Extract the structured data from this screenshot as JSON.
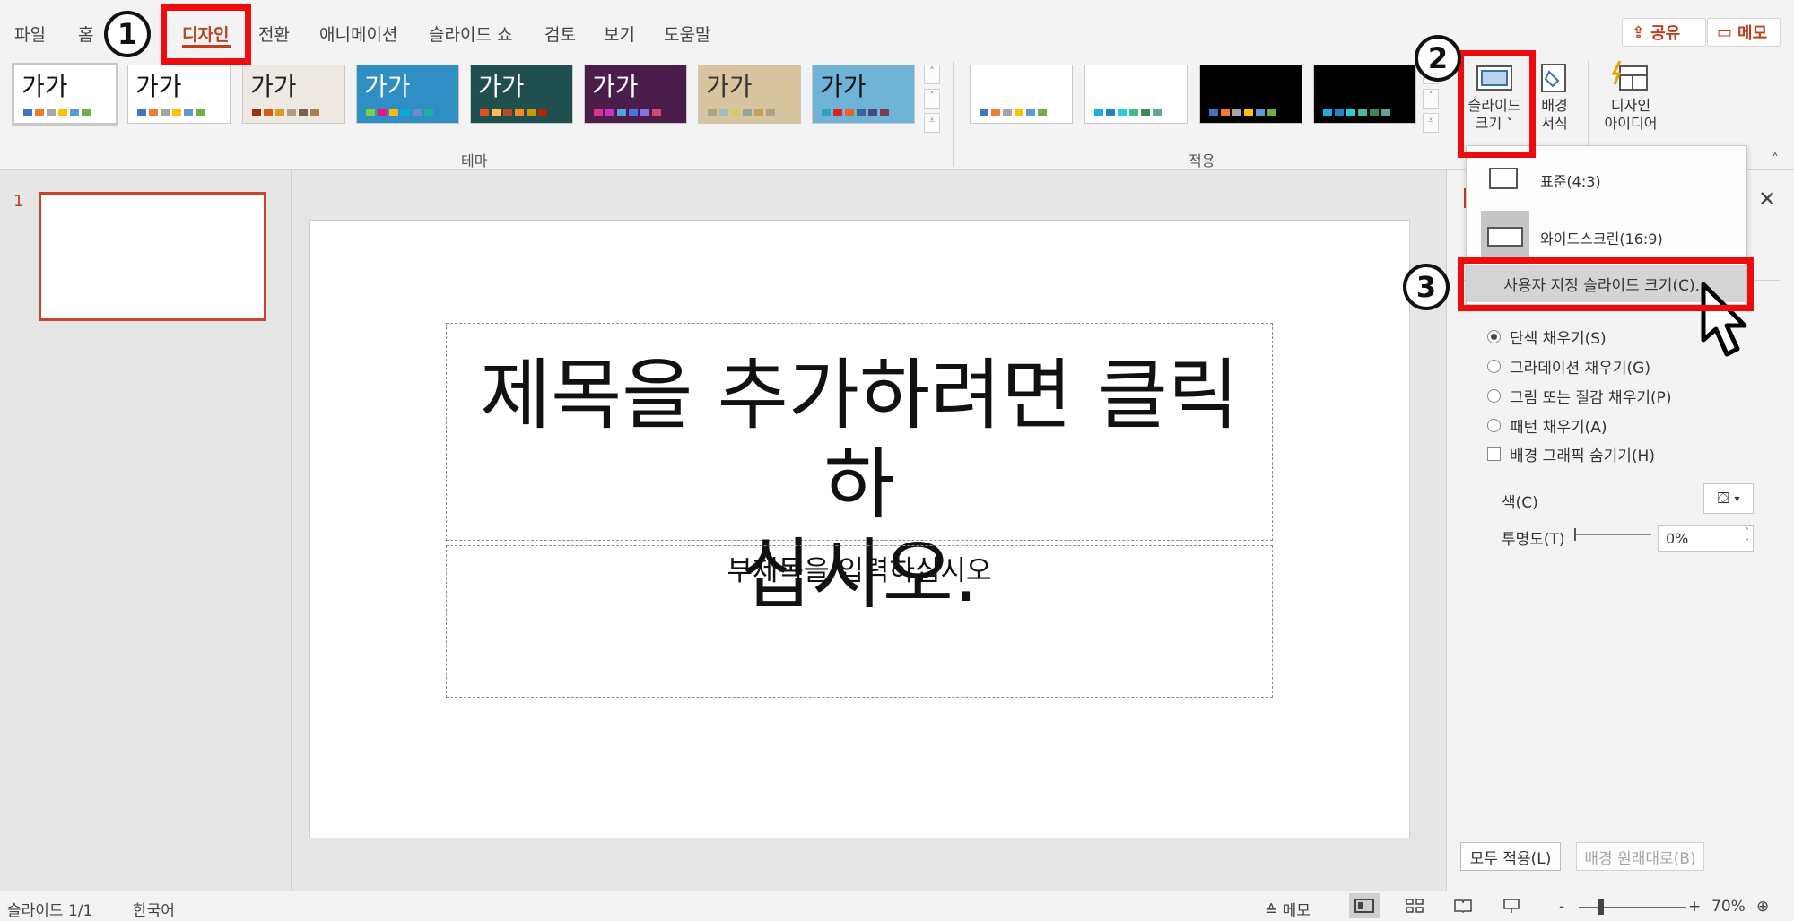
{
  "tabs": [
    {
      "label": "파일"
    },
    {
      "label": "홈"
    },
    {
      "label": "디자인"
    },
    {
      "label": "전환"
    },
    {
      "label": "애니메이션"
    },
    {
      "label": "슬라이드 쇼"
    },
    {
      "label": "검토"
    },
    {
      "label": "보기"
    },
    {
      "label": "도움말"
    }
  ],
  "header": {
    "share": "공유",
    "comments": "메모"
  },
  "ribbon": {
    "themes_label": "테마",
    "variants_label": "적용",
    "theme_thumb_text": "가가",
    "slide_size": "슬라이드\n크기",
    "slide_size_line1": "슬라이드",
    "slide_size_line2": "크기 ˅",
    "format_bg_line1": "배경",
    "format_bg_line2": "서식",
    "designer_line1": "디자인",
    "designer_line2": "아이디어"
  },
  "themes": [
    {
      "bg": "#ffffff",
      "fg": "#111111",
      "colors": [
        "#4472c4",
        "#ed7d31",
        "#a5a5a5",
        "#ffc000",
        "#5b9bd5",
        "#70ad47"
      ]
    },
    {
      "bg": "#ffffff",
      "fg": "#111111",
      "colors": [
        "#4472c4",
        "#ed7d31",
        "#a5a5a5",
        "#ffc000",
        "#5b9bd5",
        "#70ad47"
      ]
    },
    {
      "bg": "#efe9e4",
      "fg": "#222222",
      "colors": [
        "#a5300f",
        "#d55816",
        "#e19825",
        "#b19c7d",
        "#7f5f52",
        "#b27d49"
      ]
    },
    {
      "bg": "#2f8fc4",
      "fg": "#ffffff",
      "colors": [
        "#7fd13b",
        "#ea157a",
        "#feb80a",
        "#00addc",
        "#738ac8",
        "#1ab39f"
      ]
    },
    {
      "bg": "#1f4f4f",
      "fg": "#ffffff",
      "colors": [
        "#e84c22",
        "#ffbd47",
        "#b64926",
        "#ff8427",
        "#cc9900",
        "#b22600"
      ]
    },
    {
      "bg": "#4a1d4a",
      "fg": "#ffffff",
      "colors": [
        "#e32d91",
        "#c830cc",
        "#4ea6dc",
        "#4775e7",
        "#8971e1",
        "#d54773"
      ]
    },
    {
      "bg": "#d9c4a0",
      "fg": "#333333",
      "colors": [
        "#a9a57c",
        "#9cbebd",
        "#d2cb6c",
        "#95a39d",
        "#c89f5d",
        "#b1a089"
      ]
    },
    {
      "bg": "#6fb3d8",
      "fg": "#111111",
      "colors": [
        "#2da2bf",
        "#da1f28",
        "#eb641b",
        "#39639d",
        "#474b78",
        "#7d3c4a"
      ]
    }
  ],
  "variants": [
    {
      "bg": "#ffffff",
      "colors": [
        "#4472c4",
        "#ed7d31",
        "#a5a5a5",
        "#ffc000",
        "#5b9bd5",
        "#70ad47"
      ]
    },
    {
      "bg": "#ffffff",
      "colors": [
        "#1cade4",
        "#2683c6",
        "#27ced7",
        "#42ba97",
        "#3e8853",
        "#62a39f"
      ]
    },
    {
      "bg": "#000000",
      "colors": [
        "#4472c4",
        "#ed7d31",
        "#a5a5a5",
        "#ffc000",
        "#5b9bd5",
        "#70ad47"
      ]
    },
    {
      "bg": "#000000",
      "colors": [
        "#1cade4",
        "#2683c6",
        "#27ced7",
        "#42ba97",
        "#3e8853",
        "#62a39f"
      ]
    }
  ],
  "steps": {
    "one": "1",
    "two": "2",
    "three": "3"
  },
  "dropdown": {
    "standard": "표준(4:3)",
    "widescreen": "와이드스크린(16:9)",
    "custom": "사용자 지정 슬라이드 크기(C)..."
  },
  "thumbs": {
    "number": "1"
  },
  "slide": {
    "title_line1": "제목을 추가하려면 클릭하",
    "title_line2": "십시오.",
    "subtitle": "부제목을 입력하십시오"
  },
  "pane": {
    "fill_options": [
      {
        "label": "단색 채우기(S)",
        "selected": true
      },
      {
        "label": "그라데이션 채우기(G)",
        "selected": false
      },
      {
        "label": "그림 또는 질감 채우기(P)",
        "selected": false
      },
      {
        "label": "패턴 채우기(A)",
        "selected": false
      }
    ],
    "hide_bg": "배경 그래픽 숨기기(H)",
    "color_label": "색(C)",
    "transparency_label": "투명도(T)",
    "transparency_value": "0%",
    "apply_all": "모두 적용(L)",
    "reset_bg": "배경 원래대로(B)"
  },
  "status": {
    "slide_count": "슬라이드 1/1",
    "language": "한국어",
    "notes": "메모",
    "zoom": "70%",
    "zoom_minus": "-",
    "zoom_plus": "+"
  },
  "colors": {
    "accent": "#c43e1c",
    "highlight": "#ee0b0b"
  }
}
